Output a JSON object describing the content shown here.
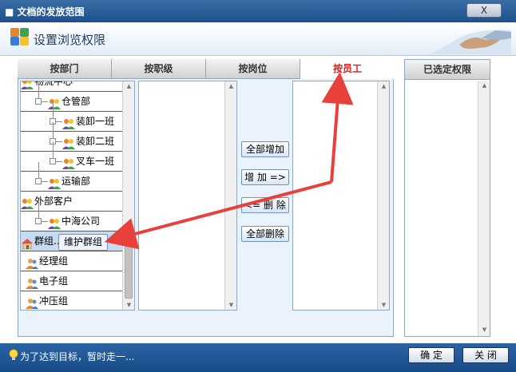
{
  "window": {
    "title": "文档的发放范围",
    "close_label": "X"
  },
  "header": {
    "title": "设置浏览权限"
  },
  "tabs": [
    {
      "label": "按部门",
      "active": false
    },
    {
      "label": "按职级",
      "active": false
    },
    {
      "label": "按岗位",
      "active": false
    },
    {
      "label": "按员工",
      "active": true
    }
  ],
  "tree": {
    "items": [
      {
        "label": "物流中心",
        "level": 0,
        "icon": "group-icon"
      },
      {
        "label": "仓管部",
        "level": 1,
        "icon": "group-icon"
      },
      {
        "label": "装卸一班",
        "level": 2,
        "icon": "group-icon"
      },
      {
        "label": "装卸二班",
        "level": 2,
        "icon": "group-icon"
      },
      {
        "label": "叉车一班",
        "level": 2,
        "icon": "group-icon"
      },
      {
        "label": "运输部",
        "level": 1,
        "icon": "group-icon"
      },
      {
        "label": "外部客户",
        "level": 0,
        "icon": "group-icon"
      },
      {
        "label": "中海公司",
        "level": 1,
        "icon": "group-icon"
      },
      {
        "label": "群组...",
        "level": 0,
        "icon": "home-icon",
        "selected": true
      },
      {
        "label": "经理组",
        "level": 0,
        "icon": "people-icon"
      },
      {
        "label": "电子组",
        "level": 0,
        "icon": "people-icon"
      },
      {
        "label": "冲压组",
        "level": 0,
        "icon": "people-icon"
      }
    ]
  },
  "tooltip": {
    "label": "维护群组"
  },
  "actions": {
    "add_all": "全部增加",
    "add": "增 加 =>",
    "remove": "<= 删 除",
    "remove_all": "全部删除"
  },
  "selected_panel": {
    "title": "已选定权限"
  },
  "footer": {
    "tip": "为了达到目标，暂时走一...",
    "ok_label": "确 定",
    "close_label": "关 闭"
  },
  "colors": {
    "title_bar": "#1d4f8c",
    "active_tab_text": "#d62020",
    "annotation_arrow": "#e8403a"
  }
}
